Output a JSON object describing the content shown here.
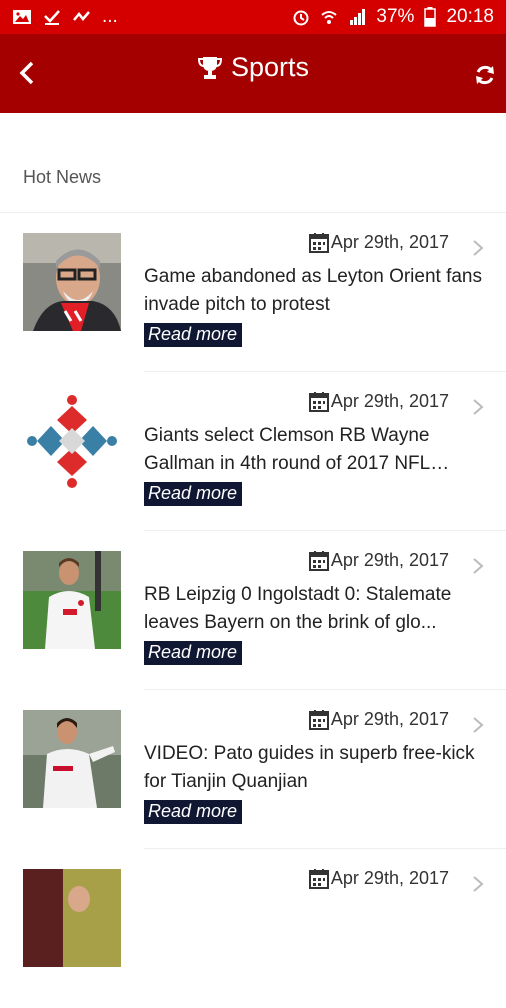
{
  "status_bar": {
    "battery": "37%",
    "time": "20:18",
    "ellipsis": "..."
  },
  "app_bar": {
    "title": "Sports"
  },
  "section": {
    "label": "Hot News"
  },
  "news": [
    {
      "date": "Apr 29th, 2017",
      "headline": "Game abandoned as Leyton Orient fans invade pitch to protest",
      "read_more": "Read more",
      "thumb": "man-with-glasses-photo"
    },
    {
      "date": "Apr 29th, 2017",
      "headline": "Giants select Clemson RB Wayne Gallman in 4th round of 2017 NFL…",
      "read_more": "Read more",
      "thumb": "red-blue-logo"
    },
    {
      "date": "Apr 29th, 2017",
      "headline": "RB Leipzig 0 Ingolstadt 0: Stalemate leaves Bayern on the brink of glo...",
      "read_more": "Read more",
      "thumb": "footballer-photo"
    },
    {
      "date": "Apr 29th, 2017",
      "headline": "VIDEO: Pato guides in superb free-kick for Tianjin Quanjian",
      "read_more": "Read more",
      "thumb": "footballer-kick-photo"
    },
    {
      "date": "Apr 29th, 2017",
      "headline": "",
      "read_more": "",
      "thumb": "footballer-photo-partial"
    }
  ],
  "colors": {
    "status_bar": "#d40000",
    "app_bar": "#a50000",
    "read_more_bg": "#0f1733"
  }
}
